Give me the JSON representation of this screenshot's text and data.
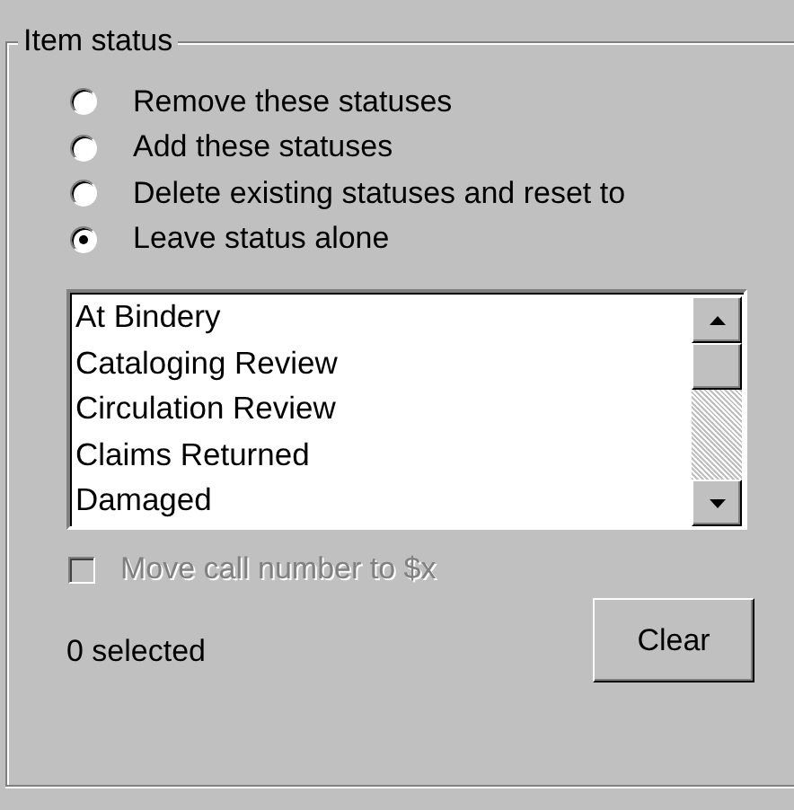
{
  "group": {
    "title": "Item status"
  },
  "options": [
    {
      "label": "Remove these statuses",
      "selected": false
    },
    {
      "label": "Add these statuses",
      "selected": false
    },
    {
      "label": "Delete existing statuses and reset to",
      "selected": false
    },
    {
      "label": "Leave status alone",
      "selected": true
    }
  ],
  "status_list": [
    {
      "label": "At Bindery",
      "selected": false
    },
    {
      "label": "Cataloging Review",
      "selected": false
    },
    {
      "label": "Circulation Review",
      "selected": false
    },
    {
      "label": "Claims Returned",
      "selected": false
    },
    {
      "label": "Damaged",
      "selected": false
    }
  ],
  "move_call_number": {
    "label": "Move call number to $x",
    "checked": false,
    "disabled": true
  },
  "selected_count": "0 selected",
  "buttons": [
    "Clear"
  ]
}
